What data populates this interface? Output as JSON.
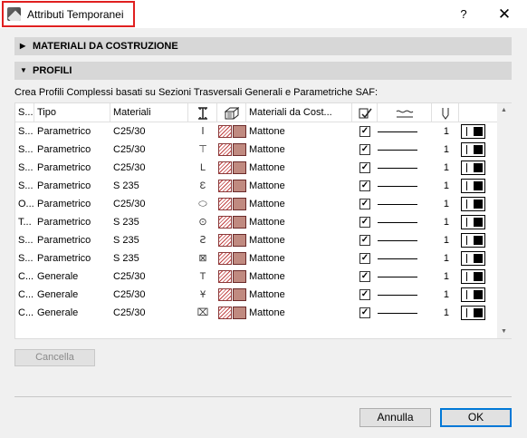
{
  "window": {
    "title": "Attributi Temporanei",
    "help": "?",
    "close": "✕"
  },
  "sections": {
    "materials": "MATERIALI DA COSTRUZIONE",
    "profiles": "PROFILI"
  },
  "description": "Crea Profili Complessi basati su Sezioni Trasversali Generali e Parametriche SAF:",
  "columns": [
    "S...",
    "Tipo",
    "Materiali",
    "section-profile-icon",
    "surface-icon",
    "Materiali da Cost...",
    "pen-check-icon",
    "line-type-icon",
    "pen-icon",
    ""
  ],
  "column_labels": {
    "s": "S...",
    "tipo": "Tipo",
    "materiali": "Materiali",
    "materiali_cost": "Materiali da Cost..."
  },
  "rows": [
    {
      "s": "S...",
      "tipo": "Parametrico",
      "materiale": "C25/30",
      "icon": "I-beam-profile-icon",
      "glyph": "Ⅰ",
      "mat_cost": "Mattone",
      "checked": true,
      "pen": "1"
    },
    {
      "s": "S...",
      "tipo": "Parametrico",
      "materiale": "C25/30",
      "icon": "T-profile-icon",
      "glyph": "⊤",
      "mat_cost": "Mattone",
      "checked": true,
      "pen": "1"
    },
    {
      "s": "S...",
      "tipo": "Parametrico",
      "materiale": "C25/30",
      "icon": "L-profile-icon",
      "glyph": "L",
      "mat_cost": "Mattone",
      "checked": true,
      "pen": "1"
    },
    {
      "s": "S...",
      "tipo": "Parametrico",
      "materiale": "S 235",
      "icon": "C-channel-profile-icon",
      "glyph": "Ɛ",
      "mat_cost": "Mattone",
      "checked": true,
      "pen": "1"
    },
    {
      "s": "O...",
      "tipo": "Parametrico",
      "materiale": "C25/30",
      "icon": "oval-profile-icon",
      "glyph": "⬭",
      "mat_cost": "Mattone",
      "checked": true,
      "pen": "1"
    },
    {
      "s": "T...",
      "tipo": "Parametrico",
      "materiale": "S 235",
      "icon": "tube-profile-icon",
      "glyph": "⊙",
      "mat_cost": "Mattone",
      "checked": true,
      "pen": "1"
    },
    {
      "s": "S...",
      "tipo": "Parametrico",
      "materiale": "S 235",
      "icon": "Z-profile-icon",
      "glyph": "Ꙅ",
      "mat_cost": "Mattone",
      "checked": true,
      "pen": "1"
    },
    {
      "s": "S...",
      "tipo": "Parametrico",
      "materiale": "S 235",
      "icon": "box-profile-icon",
      "glyph": "⊠",
      "mat_cost": "Mattone",
      "checked": true,
      "pen": "1"
    },
    {
      "s": "C...",
      "tipo": "Generale",
      "materiale": "C25/30",
      "icon": "T-beam-profile-icon",
      "glyph": "T",
      "mat_cost": "Mattone",
      "checked": true,
      "pen": "1"
    },
    {
      "s": "C...",
      "tipo": "Generale",
      "materiale": "C25/30",
      "icon": "tapered-T-profile-icon",
      "glyph": "Ұ",
      "mat_cost": "Mattone",
      "checked": true,
      "pen": "1"
    },
    {
      "s": "C...",
      "tipo": "Generale",
      "materiale": "C25/30",
      "icon": "complex-profile-icon",
      "glyph": "⌧",
      "mat_cost": "Mattone",
      "checked": true,
      "pen": "1"
    }
  ],
  "buttons": {
    "cancella": "Cancella",
    "annulla": "Annulla",
    "ok": "OK"
  },
  "colors": {
    "accent": "#0078d7",
    "highlight": "#e02020",
    "brick": "#c08a80"
  }
}
